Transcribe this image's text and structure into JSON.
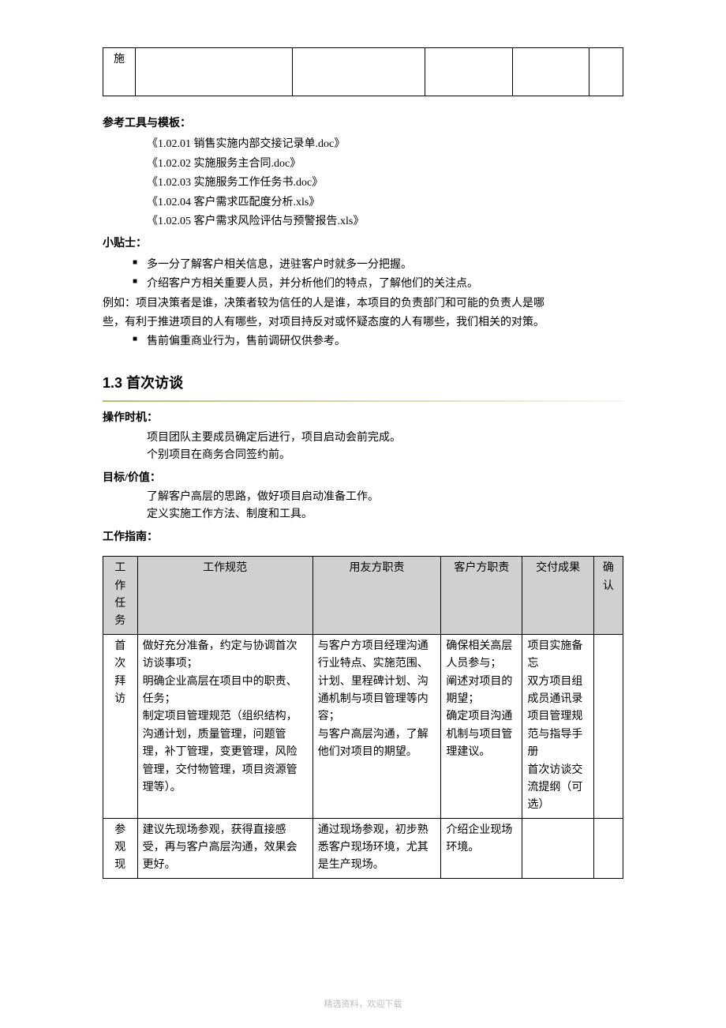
{
  "top_table": {
    "row_label": "施"
  },
  "refs": {
    "heading": "参考工具与模板：",
    "items": [
      "《1.02.01 销售实施内部交接记录单.doc》",
      "《1.02.02 实施服务主合同.doc》",
      "《1.02.03 实施服务工作任务书.doc》",
      "《1.02.04 客户需求匹配度分析.xls》",
      "《1.02.05 客户需求风险评估与预警报告.xls》"
    ]
  },
  "tips": {
    "heading": "小贴士：",
    "bullets": [
      "多一分了解客户相关信息，进驻客户时就多一分把握。",
      "介绍客户方相关重要人员，并分析他们的特点，了解他们的关注点。"
    ],
    "example_intro": "例如：项目决策者是谁，决策者较为信任的人是谁，本项目的负责部门和可能的负责人是哪",
    "example_cont": "些，有利于推进项目的人有哪些，对项目持反对或怀疑态度的人有哪些，我们相关的对策。",
    "last_bullet": "售前偏重商业行为，售前调研仅供参考。"
  },
  "section": {
    "number_title": "1.3 首次访谈",
    "timing_label": "操作时机：",
    "timing_lines": [
      "项目团队主要成员确定后进行，项目启动会前完成。",
      "个别项目在商务合同签约前。"
    ],
    "goal_label": "目标/价值：",
    "goal_lines": [
      "了解客户高层的思路，做好项目启动准备工作。",
      "定义实施工作方法、制度和工具。"
    ],
    "guide_label": "工作指南："
  },
  "guide_table": {
    "headers": [
      "工作任务",
      "工作规范",
      "用友方职责",
      "客户方职责",
      "交付成果",
      "确认"
    ],
    "rows": [
      {
        "task": "首次拜访",
        "spec": "做好充分准备，约定与协调首次访谈事项；\n明确企业高层在项目中的职责、任务；\n制定项目管理规范（组织结构，沟通计划，质量管理，问题管理，补丁管理，变更管理，风险管理，交付物管理，项目资源管理等）。",
        "yonyou": "与客户方项目经理沟通行业特点、实施范围、计划、里程碑计划、沟通机制与项目管理等内容；\n与客户高层沟通，了解他们对项目的期望。",
        "customer": "确保相关高层人员参与；\n阐述对项目的期望；\n确定项目沟通机制与项目管理建议。",
        "deliver": "项目实施备忘\n双方项目组成员通讯录\n项目管理规范与指导手册\n首次访谈交流提纲（可选）",
        "confirm": ""
      },
      {
        "task": "参观现",
        "spec": "建议先现场参观，获得直接感受，再与客户高层沟通，效果会更好。",
        "yonyou": "通过现场参观，初步熟悉客户现场环境，尤其是生产现场。",
        "customer": "介绍企业现场环境。",
        "deliver": "",
        "confirm": ""
      }
    ]
  },
  "footer": "精选资料，欢迎下载"
}
